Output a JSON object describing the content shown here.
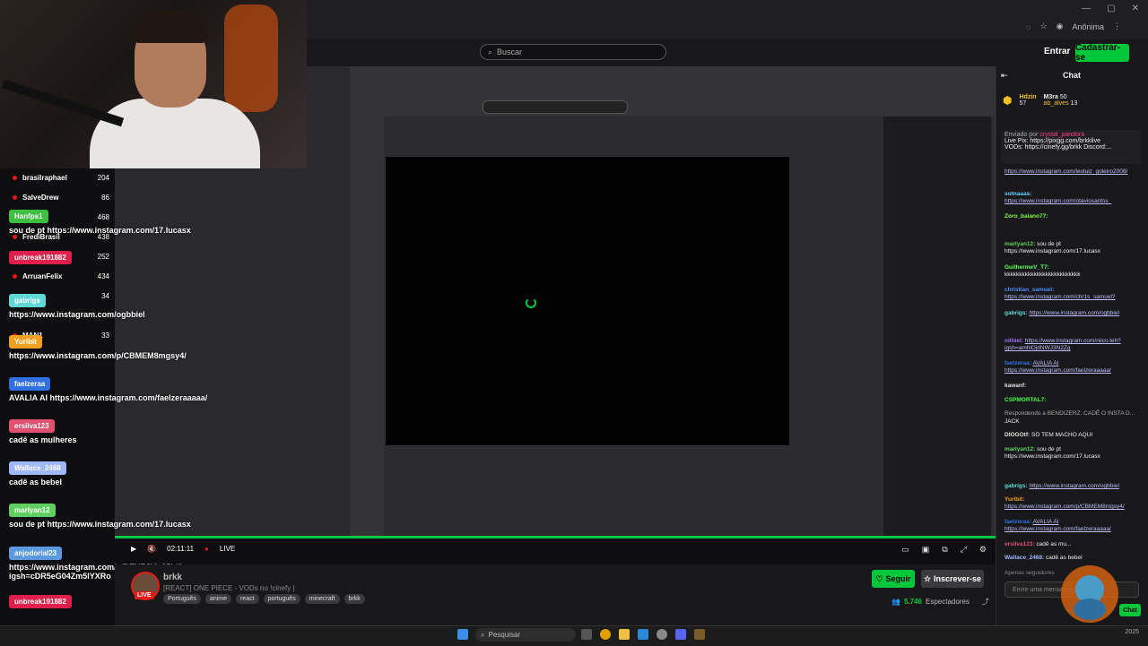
{
  "browser": {
    "mode_label": "Anônima",
    "win_controls": [
      "—",
      "▢",
      "✕"
    ]
  },
  "header": {
    "search_placeholder": "Buscar",
    "login_label": "Entrar",
    "signup_label": "Cadastrar-se"
  },
  "overlay_leaderboard": [
    {
      "name": "brasilraphael",
      "count": "204"
    },
    {
      "name": "SalveDrew",
      "count": "86"
    },
    {
      "name": "",
      "count": "468"
    },
    {
      "name": "FrediBrasil",
      "count": "438"
    },
    {
      "name": "",
      "count": "252"
    },
    {
      "name": "ArruanFelix",
      "count": "434"
    },
    {
      "name": "",
      "count": "34"
    },
    {
      "name": "MAN1",
      "count": "33"
    }
  ],
  "overlay_chat": [
    {
      "user": "Hanfps1",
      "color": "#3fbf3f",
      "text": "sou de pt https://www.instagram.com/17.lucasx"
    },
    {
      "user": "unbreak191882",
      "color": "#e0204a",
      "text": ""
    },
    {
      "user": "gabrigs",
      "color": "#5fd8d8",
      "text": "https://www.instagram.com/ogbbiel"
    },
    {
      "user": "Yuribit",
      "color": "#f0a020",
      "text": "https://www.instagram.com/p/CBMEM8mgsy4/"
    },
    {
      "user": "faelzeraa",
      "color": "#3070e0",
      "text": "AVALIA AI https://www.instagram.com/faelzeraaaaa/"
    },
    {
      "user": "ersilva123",
      "color": "#e05070",
      "text": "cadê as mulheres"
    },
    {
      "user": "Wallace_2468",
      "color": "#a0b8ff",
      "text": "cadê as bebel"
    },
    {
      "user": "marlyan12",
      "color": "#60d060",
      "text": "sou de pt https://www.instagram.com/17.lucasx"
    },
    {
      "user": "anjodorial23",
      "color": "#5a9ae0",
      "text": "https://www.instagram.com/p/DEUZJldx35h/?igsh=cDR5eG04Zm5lYXRo"
    },
    {
      "user": "unbreak191882",
      "color": "#e0204a",
      "text": ""
    }
  ],
  "player": {
    "time": "02:11:11",
    "live_label": "LIVE"
  },
  "channel": {
    "name": "brkk",
    "title": "[REACT] ONE PIECE - VODs no !cinefy |",
    "live_badge": "LIVE",
    "tags": [
      "Português",
      "anime",
      "react",
      "português",
      "minecraft",
      "brkk"
    ],
    "follow_label": "Seguir",
    "subscribe_label": "Inscrever-se",
    "viewers": "5.746",
    "viewers_label": "Espectadores"
  },
  "chat": {
    "title": "Chat",
    "leaders": [
      {
        "name": "Hdzin",
        "score": "57"
      },
      {
        "name": "M3ra",
        "score": "50"
      },
      {
        "name": "ab_alves",
        "score": "13"
      }
    ],
    "pinned_by": "Enviado por",
    "pinned_user": "crystal_pandora",
    "pinned_line1": "Live Pix: https://pixgg.com/brkklive",
    "pinned_line2": "VODs: https://cinefy.gg/brkk Discord:...",
    "messages": [
      {
        "user": "",
        "color": "#e0e0e0",
        "text": "https://www.instagram.com/leoluiz_goleiro2008/"
      },
      {
        "user": "sotnaaas:",
        "color": "#60d0ff",
        "text": "https://www.instagram.com/otaviosantss_"
      },
      {
        "user": "Zoro_baiano77:",
        "color": "#80ff40",
        "text": ""
      },
      {
        "user": "",
        "color": "#e0204a",
        "text": ""
      },
      {
        "user": "marlyan12:",
        "color": "#60d060",
        "text": "sou de pt https://www.instagram.com/17.lucasx"
      },
      {
        "user": "GuilhermeV_T7:",
        "color": "#60ff60",
        "text": "kkkkkkkkkkkkkkkkkkkkkkkkkk"
      },
      {
        "user": "christian_samuel:",
        "color": "#4f8fff",
        "text": "https://www.instagram.com/chr1s_samuel?"
      },
      {
        "user": "gabrigs:",
        "color": "#5fd8d8",
        "text": "https://www.instagram.com/ogbbiel"
      },
      {
        "user": "",
        "color": "#e0204a",
        "text": ""
      },
      {
        "user": "niihiel:",
        "color": "#a070ff",
        "text": "https://www.instagram.com/niico.leh?igsh=amhlOjdNWJ3N2Zg"
      },
      {
        "user": "faelzeraa:",
        "color": "#3070e0",
        "text": "AVALIA AI https://www.instagram.com/faelzeraaaaa/"
      },
      {
        "user": "kawanf:",
        "color": "#e0e0e0",
        "text": ""
      },
      {
        "user": "CSPMORTAL7:",
        "color": "#40ff40",
        "text": ""
      },
      {
        "user": "Respondendo a BENDIZERZ:",
        "color": "#aaaaaa",
        "text": "CADÊ O INSTA D..."
      },
      {
        "user": "",
        "color": "#e0204a",
        "text": "JACK"
      },
      {
        "user": "DIOGOtf:",
        "color": "#e0e0e0",
        "text": "SO TEM MACHO AQUI"
      },
      {
        "user": "marlyan12:",
        "color": "#60d060",
        "text": "sou de pt https://www.instagram.com/17.lucasx"
      },
      {
        "user": "",
        "color": "#e0204a",
        "text": ""
      },
      {
        "user": "gabrigs:",
        "color": "#5fd8d8",
        "text": "https://www.instagram.com/ogbbiel"
      },
      {
        "user": "Yuribit:",
        "color": "#f0a020",
        "text": "https://www.instagram.com/p/CBMEM8mgsy4/"
      },
      {
        "user": "faelzeraa:",
        "color": "#3070e0",
        "text": "AVALIA AI https://www.instagram.com/faelzeraaaaa/"
      },
      {
        "user": "ersilva123:",
        "color": "#e05070",
        "text": "cadê as mu..."
      },
      {
        "user": "Wallace_2468:",
        "color": "#a0b8ff",
        "text": "cadê as bebel"
      }
    ],
    "replies_label": "Apenas seguidores",
    "input_placeholder": "Envie uma mensagem",
    "send_label": "Chat"
  },
  "taskbar": {
    "search_placeholder": "Pesquisar",
    "date": "2025"
  },
  "colors": {
    "accent": "#00c83a",
    "live": "#e91916"
  }
}
